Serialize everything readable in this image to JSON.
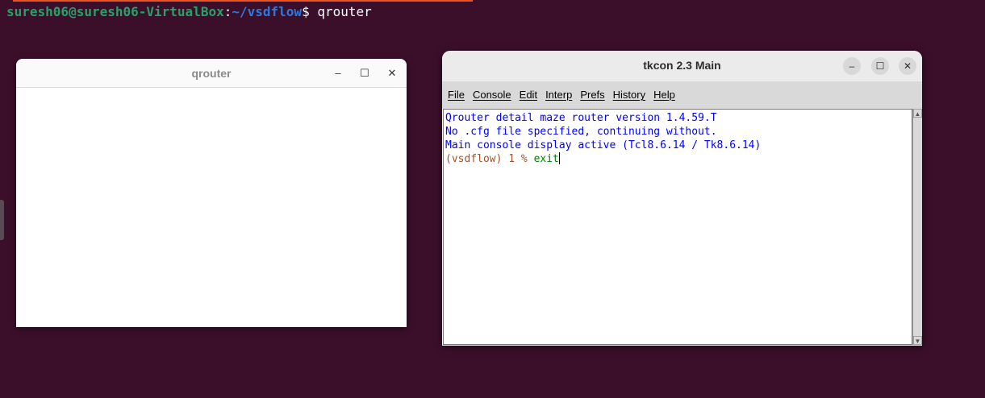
{
  "terminal": {
    "user_host": "suresh06@suresh06-VirtualBox",
    "separator": ":",
    "path": "~/vsdflow",
    "dollar": "$ ",
    "command": "qrouter"
  },
  "qrouter_window": {
    "title": "qrouter",
    "minimize": "–",
    "maximize": "☐",
    "close": "✕"
  },
  "tkcon_window": {
    "title": "tkcon 2.3 Main",
    "minimize": "–",
    "maximize": "☐",
    "close": "✕",
    "menu": [
      "File",
      "Console",
      "Edit",
      "Interp",
      "Prefs",
      "History",
      "Help"
    ],
    "output": [
      "Qrouter detail maze router version 1.4.59.T",
      "No .cfg file specified, continuing without.",
      "Main console display active (Tcl8.6.14 / Tk8.6.14)"
    ],
    "prompt": "(vsdflow) 1 % ",
    "input": "exit"
  },
  "colors": {
    "desktop_bg": "#3b0f2a",
    "accent": "#e95420",
    "output_text": "#0000ff",
    "prompt_text": "#a0522d",
    "input_text": "#008000"
  }
}
